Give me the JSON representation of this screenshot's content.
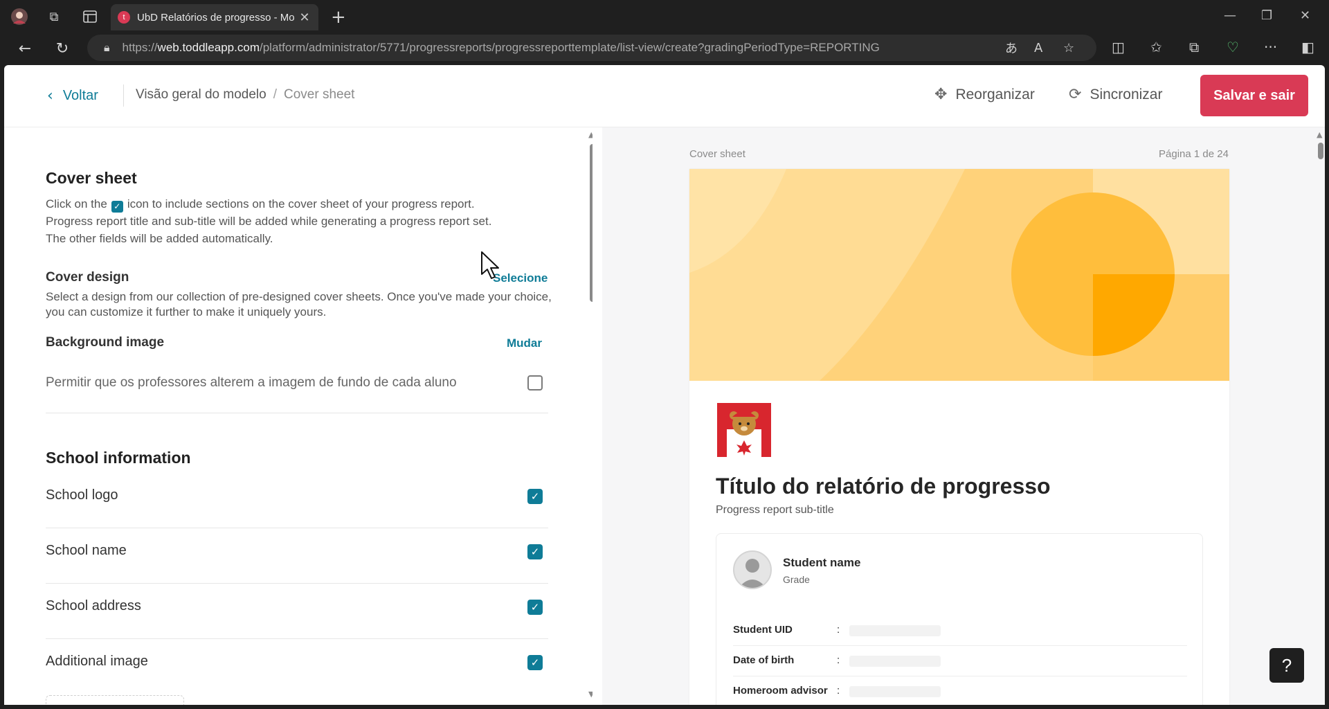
{
  "browser": {
    "tab_title": "UbD Relatórios de progresso - Mo",
    "tab_favicon_letter": "t",
    "url_prefix": "https://",
    "url_domain": "web.toddleapp.com",
    "url_path": "/platform/administrator/5771/progressreports/progressreporttemplate/list-view/create?gradingPeriodType=REPORTING"
  },
  "header": {
    "back_label": "Voltar",
    "breadcrumb_parent": "Visão geral do modelo",
    "breadcrumb_separator": "/",
    "breadcrumb_current": "Cover sheet",
    "reorganize_label": "Reorganizar",
    "sync_label": "Sincronizar",
    "save_label": "Salvar e sair"
  },
  "left_panel": {
    "cover_sheet": {
      "title": "Cover sheet",
      "desc_part1": "Click on the",
      "desc_part2": "icon to include sections on the cover sheet of your progress report.",
      "desc_line2": "Progress report title and sub-title will be added while generating a progress report set.",
      "desc_line3": "The other fields will be added automatically."
    },
    "cover_design": {
      "title": "Cover design",
      "action": "Selecione",
      "desc": "Select a design from our collection of pre-designed cover sheets. Once you've made your choice, you can customize it further to make it uniquely yours."
    },
    "background_image": {
      "title": "Background image",
      "action": "Mudar",
      "option_label": "Permitir que os professores alterem a imagem de fundo de cada aluno",
      "option_checked": false
    },
    "school_information": {
      "title": "School information",
      "rows": [
        {
          "label": "School logo",
          "checked": true
        },
        {
          "label": "School name",
          "checked": true
        },
        {
          "label": "School address",
          "checked": true
        },
        {
          "label": "Additional image",
          "checked": true
        }
      ]
    }
  },
  "preview": {
    "section_label": "Cover sheet",
    "page_indicator": "Página 1 de 24",
    "title": "Título do relatório de progresso",
    "subtitle": "Progress report sub-title",
    "student": {
      "name": "Student name",
      "grade": "Grade",
      "fields": [
        {
          "label": "Student UID",
          "colon": ":"
        },
        {
          "label": "Date of birth",
          "colon": ":"
        },
        {
          "label": "Homeroom advisor",
          "colon": ":"
        }
      ]
    },
    "colors": {
      "banner_light": "#ffe3a6",
      "banner_mid": "#ffd27a",
      "banner_deep": "#ffbe3c",
      "banner_accent": "#ffa800"
    }
  },
  "help": {
    "label": "?"
  },
  "theme": {
    "accent": "#0f7c97",
    "primary_button": "#d93a55"
  }
}
